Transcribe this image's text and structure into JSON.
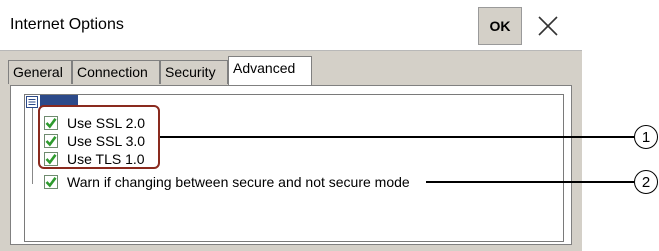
{
  "window": {
    "title": "Internet Options",
    "ok_label": "OK"
  },
  "tabs": [
    {
      "label": "General"
    },
    {
      "label": "Connection"
    },
    {
      "label": "Security"
    },
    {
      "label": "Advanced",
      "active": true
    }
  ],
  "tree": {
    "root_icon": "tree-root-icon",
    "items": [
      {
        "label": "Use SSL 2.0",
        "checked": true
      },
      {
        "label": "Use SSL 3.0",
        "checked": true
      },
      {
        "label": "Use TLS 1.0",
        "checked": true
      },
      {
        "label": "Warn if changing between secure and not secure mode",
        "checked": true
      }
    ]
  },
  "callouts": [
    {
      "label": "1"
    },
    {
      "label": "2"
    }
  ],
  "colors": {
    "window_bg": "#d4d0c8",
    "check_green": "#2e9b2e",
    "highlight": "#8a2a1e"
  }
}
